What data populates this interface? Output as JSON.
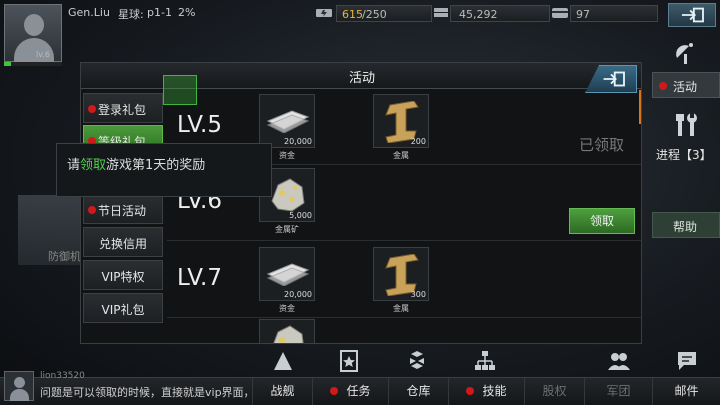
{
  "player": {
    "name": "Gen.Liu",
    "planet_label": "星球:",
    "planet": "p1-1",
    "percent": "2%",
    "level_tag": "lv.6",
    "hp_fraction": 0.12
  },
  "resources": {
    "energy_current": "615",
    "energy_max": "/250",
    "money": "45,292",
    "cards": "97"
  },
  "icons": {
    "avatar": "avatar-icon",
    "energy": "energy-icon",
    "money": "money-icon",
    "card": "card-icon",
    "exit": "exit-icon",
    "radar": "radar-icon",
    "tools": "tools-icon",
    "close": "close-icon"
  },
  "side_menu": {
    "activity": "活动",
    "progress": "进程【3】",
    "help": "帮助"
  },
  "background": {
    "defense_label": "防御机"
  },
  "panel": {
    "title": "活动",
    "menu": [
      {
        "label": "登录礼包",
        "dot": true
      },
      {
        "label": "等级礼包",
        "dot": true
      },
      {
        "label": "节日活动",
        "dot": true
      },
      {
        "label": "兑换信用",
        "dot": false
      },
      {
        "label": "VIP特权",
        "dot": false
      },
      {
        "label": "VIP礼包",
        "dot": false
      }
    ],
    "rows": [
      {
        "level": "LV.5",
        "items": [
          {
            "name": "资金",
            "qty": "20,000"
          },
          {
            "name": "金属",
            "qty": "200"
          }
        ],
        "status": "已领取"
      },
      {
        "level": "LV.6",
        "items": [
          {
            "name": "金属矿",
            "qty": "5,000"
          }
        ],
        "button": "领取"
      },
      {
        "level": "LV.7",
        "items": [
          {
            "name": "资金",
            "qty": "20,000"
          },
          {
            "name": "金属",
            "qty": "300"
          }
        ]
      }
    ]
  },
  "tooltip": {
    "prefix": "请",
    "highlight": "领取",
    "suffix": "游戏第1天的奖励"
  },
  "chat": {
    "user": "lion33520",
    "message": "问题是可以领取的时候，直接就是vip界面，"
  },
  "bottom_tabs": [
    {
      "label": "战舰",
      "dot": false,
      "dim": false
    },
    {
      "label": "任务",
      "dot": true,
      "dim": false
    },
    {
      "label": "仓库",
      "dot": false,
      "dim": false
    },
    {
      "label": "技能",
      "dot": true,
      "dim": false
    },
    {
      "label": "股权",
      "dot": false,
      "dim": true
    },
    {
      "label": "军团",
      "dot": false,
      "dim": true
    },
    {
      "label": "邮件",
      "dot": false,
      "dim": false
    }
  ],
  "colors": {
    "accent_green": "#4fd24f",
    "energy_text": "#e3b93b",
    "notify_dot": "#d01919",
    "orange_edge": "#d8761c"
  }
}
